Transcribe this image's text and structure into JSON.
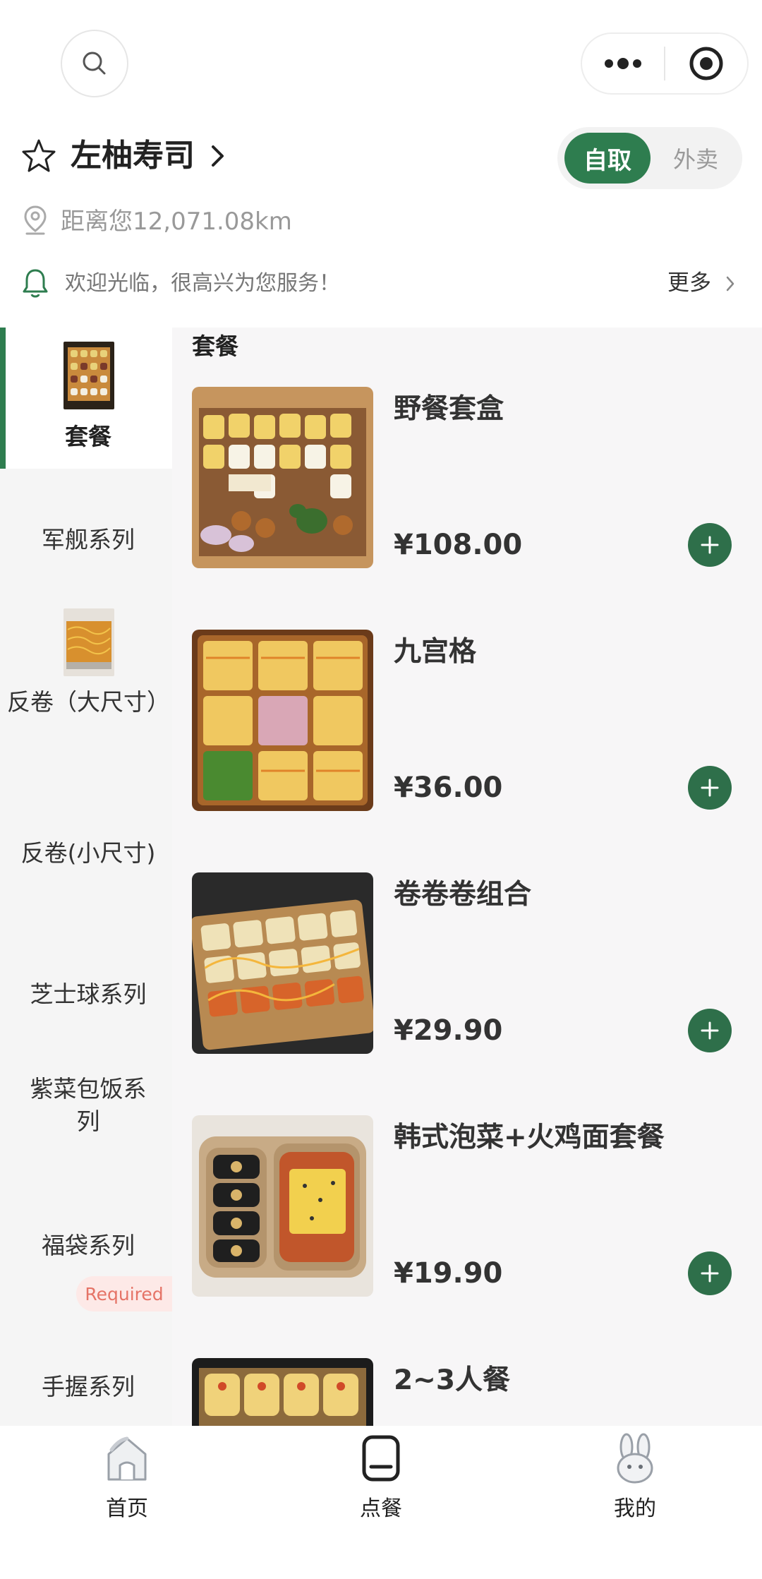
{
  "header": {
    "search_icon": "search-icon",
    "capsule": {
      "more_icon": "more-dots-icon",
      "close_icon": "target-icon"
    }
  },
  "store": {
    "name": "左柚寿司",
    "mode_active": "自取",
    "mode_inactive": "外卖",
    "distance": "距离您12,071.08km",
    "notice": "欢迎光临，很高兴为您服务！",
    "more": "更多"
  },
  "colors": {
    "accent": "#2e7d4f",
    "add_button": "#2e6f4a",
    "required_bg": "#fde9e7",
    "required_text": "#e57366"
  },
  "categories": [
    {
      "label": "套餐",
      "active": true,
      "has_thumb": true
    },
    {
      "label": "军舰系列"
    },
    {
      "label": "反卷（大尺寸）",
      "has_thumb": true
    },
    {
      "label": "反卷(小尺寸)"
    },
    {
      "label": "芝士球系列"
    },
    {
      "label": "紫菜包饭系列"
    },
    {
      "label": "福袋系列",
      "badge": "Required"
    },
    {
      "label": "手握系列"
    }
  ],
  "section": {
    "title": "套餐"
  },
  "products": [
    {
      "name": "野餐套盒",
      "price": "¥108.00"
    },
    {
      "name": "九宫格",
      "price": "¥36.00"
    },
    {
      "name": "卷卷卷组合",
      "price": "¥29.90"
    },
    {
      "name": "韩式泡菜+火鸡面套餐",
      "price": "¥19.90"
    },
    {
      "name": "2~3人餐",
      "price": ""
    }
  ],
  "tabs": [
    {
      "label": "首页",
      "icon": "house-icon"
    },
    {
      "label": "点餐",
      "icon": "order-icon"
    },
    {
      "label": "我的",
      "icon": "rabbit-icon"
    }
  ]
}
